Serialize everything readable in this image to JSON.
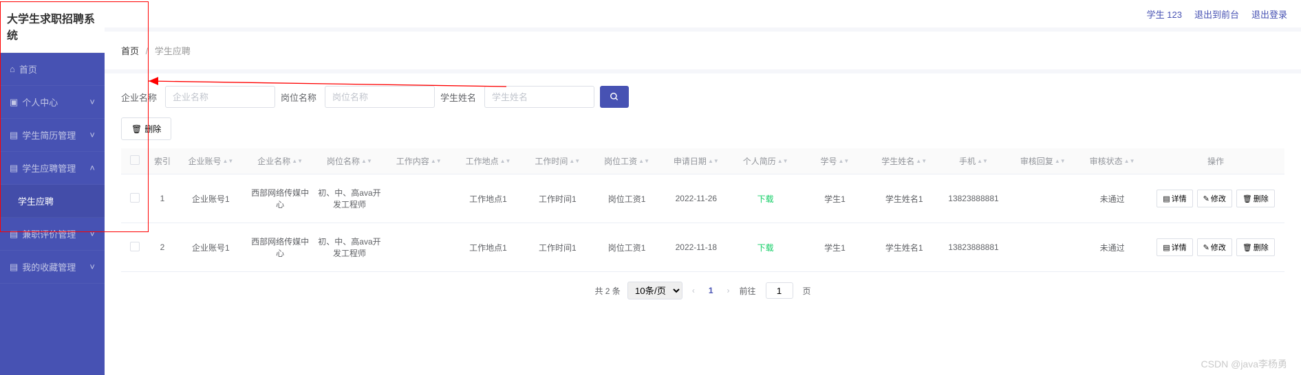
{
  "app_title": "大学生求职招聘系统",
  "topbar": {
    "user": "学生 123",
    "exit_front": "退出到前台",
    "logout": "退出登录"
  },
  "sidebar": [
    {
      "label": "首页",
      "expandable": false
    },
    {
      "label": "个人中心",
      "expandable": true,
      "open": false
    },
    {
      "label": "学生简历管理",
      "expandable": true,
      "open": false
    },
    {
      "label": "学生应聘管理",
      "expandable": true,
      "open": true,
      "children": [
        {
          "label": "学生应聘"
        }
      ]
    },
    {
      "label": "兼职评价管理",
      "expandable": true,
      "open": false
    },
    {
      "label": "我的收藏管理",
      "expandable": true,
      "open": false
    }
  ],
  "breadcrumb": {
    "home": "首页",
    "current": "学生应聘"
  },
  "filters": [
    {
      "label": "企业名称",
      "placeholder": "企业名称"
    },
    {
      "label": "岗位名称",
      "placeholder": "岗位名称"
    },
    {
      "label": "学生姓名",
      "placeholder": "学生姓名"
    }
  ],
  "buttons": {
    "delete": "删除",
    "detail": "详情",
    "modify": "修改",
    "row_delete": "删除"
  },
  "columns": [
    "索引",
    "企业账号",
    "企业名称",
    "岗位名称",
    "工作内容",
    "工作地点",
    "工作时间",
    "岗位工资",
    "申请日期",
    "个人简历",
    "学号",
    "学生姓名",
    "手机",
    "审核回复",
    "审核状态",
    "操作"
  ],
  "rows": [
    {
      "idx": "1",
      "cells": [
        "企业账号1",
        "西部网络传媒中心",
        "初、中、高ava开发工程师",
        "",
        "工作地点1",
        "工作时间1",
        "岗位工资1",
        "2022-11-26",
        "下载",
        "学生1",
        "学生姓名1",
        "13823888881",
        "",
        "未通过"
      ]
    },
    {
      "idx": "2",
      "cells": [
        "企业账号1",
        "西部网络传媒中心",
        "初、中、高ava开发工程师",
        "",
        "工作地点1",
        "工作时间1",
        "岗位工资1",
        "2022-11-18",
        "下载",
        "学生1",
        "学生姓名1",
        "13823888881",
        "",
        "未通过"
      ]
    }
  ],
  "pagination": {
    "total_label": "共 2 条",
    "page_size": "10条/页",
    "current": "1",
    "goto_label_pre": "前往",
    "goto_value": "1",
    "goto_label_post": "页"
  },
  "watermark": "CSDN @java李杨勇"
}
